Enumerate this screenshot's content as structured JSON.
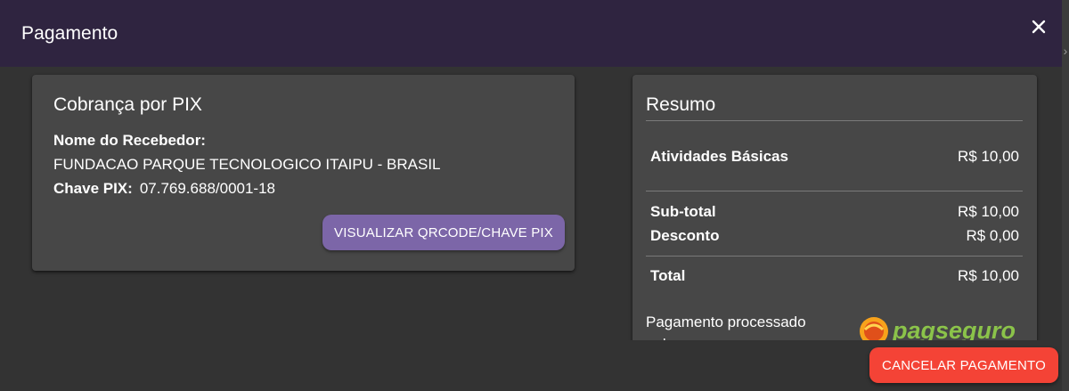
{
  "dialog": {
    "title": "Pagamento",
    "close_icon": "close-icon"
  },
  "pix": {
    "title": "Cobrança por PIX",
    "recipient_label": "Nome do Recebedor:",
    "recipient_name": "FUNDACAO PARQUE TECNOLOGICO ITAIPU - BRASIL",
    "key_label": "Chave PIX:",
    "key_value": "07.769.688/0001-18",
    "show_button_label": "VISUALIZAR QRCODE/CHAVE PIX"
  },
  "summary": {
    "title": "Resumo",
    "items": [
      {
        "label": "Atividades Básicas",
        "value": "R$ 10,00"
      }
    ],
    "subtotal_label": "Sub-total",
    "subtotal_value": "R$ 10,00",
    "discount_label": "Desconto",
    "discount_value": "R$ 0,00",
    "total_label": "Total",
    "total_value": "R$ 10,00",
    "processed_text": "Pagamento processado",
    "processed_text_cont": "pelo",
    "logo_text": "pagseguro"
  },
  "footer": {
    "cancel_label": "CANCELAR PAGAMENTO"
  },
  "colors": {
    "header_bg": "#2f2440",
    "card_bg": "#474747",
    "primary_button": "#7c66a8",
    "danger_button": "#f44336",
    "pagseguro_green": "#8bc34a",
    "pagseguro_orange": "#f7a21b"
  }
}
